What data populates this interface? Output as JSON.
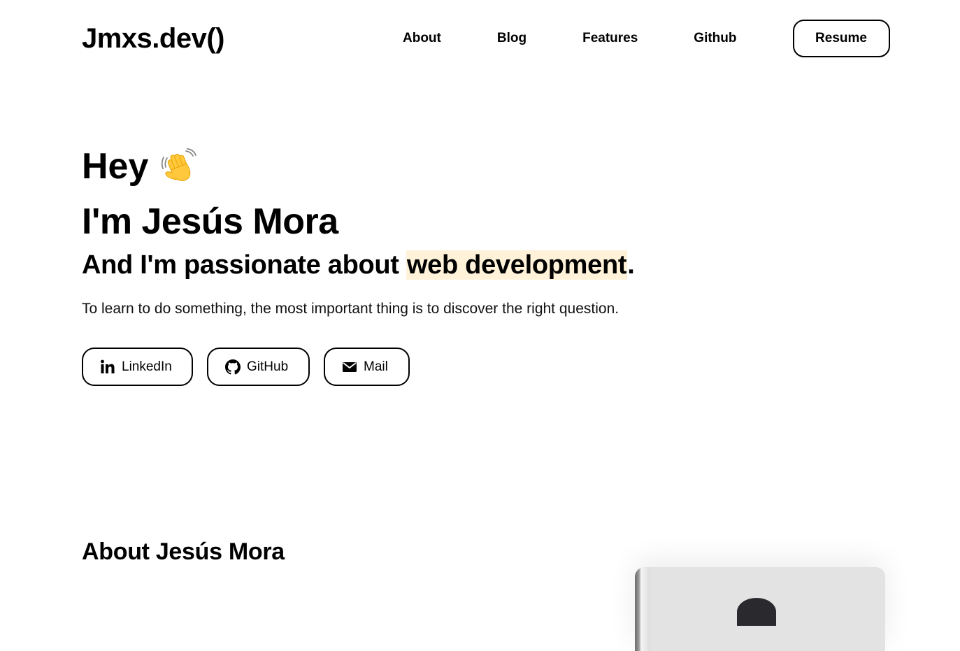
{
  "header": {
    "logo": "Jmxs.dev()",
    "nav": {
      "about": "About",
      "blog": "Blog",
      "features": "Features",
      "github": "Github"
    },
    "resume_label": "Resume"
  },
  "hero": {
    "greeting": "Hey",
    "wave_icon": "waving-hand-icon",
    "name_line": "I'm Jesús Mora",
    "tagline_prefix": "And I'm passionate about ",
    "tagline_highlight": "web development",
    "tagline_suffix": ".",
    "quote": "To learn to do something, the most important thing is to discover the right question.",
    "highlight_color": "#fff2d9",
    "social": [
      {
        "label": "LinkedIn",
        "icon": "linkedin-icon"
      },
      {
        "label": "GitHub",
        "icon": "github-icon"
      },
      {
        "label": "Mail",
        "icon": "mail-icon"
      }
    ]
  },
  "about": {
    "heading": "About Jesús Mora"
  }
}
